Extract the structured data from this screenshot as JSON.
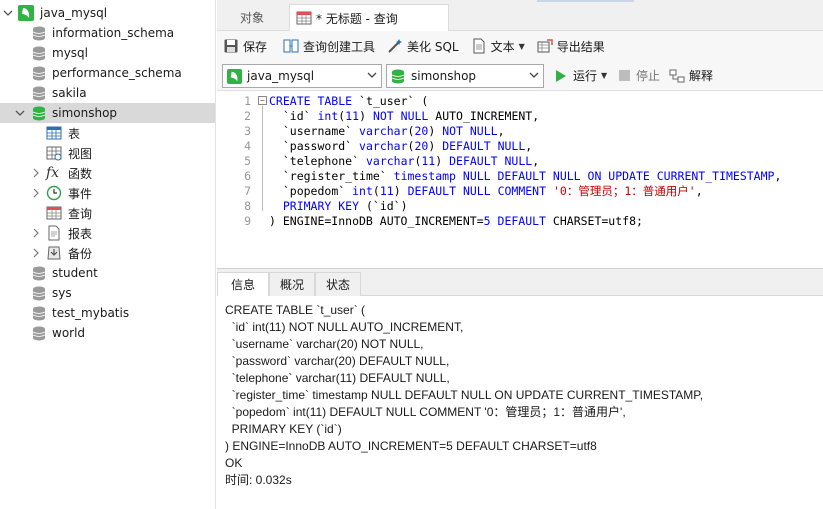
{
  "sidebar": {
    "connection": "java_mysql",
    "databases": [
      "information_schema",
      "mysql",
      "performance_schema",
      "sakila"
    ],
    "selected_db": "simonshop",
    "children": [
      {
        "label": "表",
        "icon": "table-icon"
      },
      {
        "label": "视图",
        "icon": "view-icon"
      },
      {
        "label": "函数",
        "icon": "function-icon"
      },
      {
        "label": "事件",
        "icon": "event-icon"
      },
      {
        "label": "查询",
        "icon": "query-icon"
      },
      {
        "label": "报表",
        "icon": "report-icon"
      },
      {
        "label": "备份",
        "icon": "backup-icon"
      }
    ],
    "more_databases": [
      "student",
      "sys",
      "test_mybatis",
      "world"
    ]
  },
  "tabs": {
    "objects": "对象",
    "query": "* 无标题 - 查询"
  },
  "toolbar": {
    "save": "保存",
    "query_builder": "查询创建工具",
    "beautify": "美化 SQL",
    "text": "文本",
    "export": "导出结果"
  },
  "selectors": {
    "connection": "java_mysql",
    "database": "simonshop",
    "run": "运行",
    "stop": "停止",
    "explain": "解释"
  },
  "editor": {
    "line_numbers": [
      "1",
      "2",
      "3",
      "4",
      "5",
      "6",
      "7",
      "8",
      "9"
    ]
  },
  "results": {
    "tabs": [
      "信息",
      "概况",
      "状态"
    ],
    "lines": [
      "CREATE TABLE `t_user` (",
      "  `id` int(11) NOT NULL AUTO_INCREMENT,",
      "  `username` varchar(20) NOT NULL,",
      "  `password` varchar(20) DEFAULT NULL,",
      "  `telephone` varchar(11) DEFAULT NULL,",
      "  `register_time` timestamp NULL DEFAULT NULL ON UPDATE CURRENT_TIMESTAMP,",
      "  `popedom` int(11) DEFAULT NULL COMMENT '0：管理员；1：普通用户',",
      "  PRIMARY KEY (`id`)",
      ") ENGINE=InnoDB AUTO_INCREMENT=5 DEFAULT CHARSET=utf8",
      "OK",
      "时间: 0.032s"
    ]
  },
  "colors": {
    "keyword": "#0000ff",
    "string": "#c00000",
    "connection_green": "#2fb344",
    "selected_row": "#d9d9d9"
  }
}
